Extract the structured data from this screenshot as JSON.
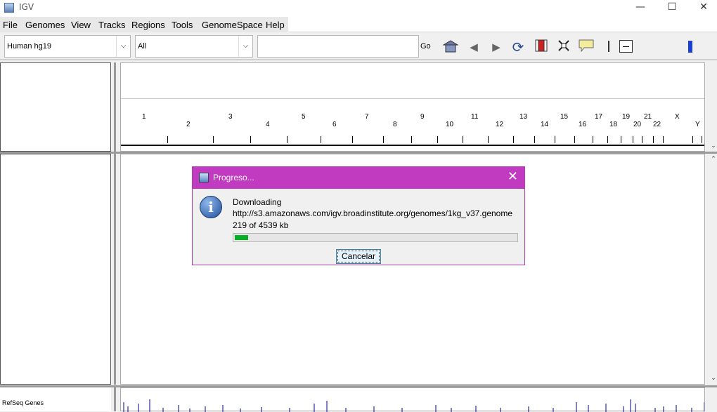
{
  "window": {
    "title": "IGV",
    "minimize": "—",
    "maximize": "☐",
    "close": "✕"
  },
  "menu": [
    "File",
    "Genomes",
    "View",
    "Tracks",
    "Regions",
    "Tools",
    "GenomeSpace",
    "Help"
  ],
  "toolbar": {
    "genome": "Human hg19",
    "chromosome": "All",
    "locus_value": "",
    "go_label": "Go",
    "icons": [
      "home-icon",
      "back-icon",
      "forward-icon",
      "refresh-icon",
      "roi-icon",
      "resize-icon",
      "popup-text-icon",
      "ruler-icon",
      "zoom-out-icon",
      "zoom-level-icon"
    ]
  },
  "ruler": {
    "chromosomes_top": [
      "1",
      "3",
      "5",
      "7",
      "9",
      "11",
      "13",
      "15",
      "17",
      "19",
      "21",
      "X"
    ],
    "chromosomes_bottom": [
      "2",
      "4",
      "6",
      "8",
      "10",
      "12",
      "14",
      "16",
      "18",
      "20",
      "22",
      "Y"
    ]
  },
  "dialog": {
    "title": "Progreso...",
    "line1": "Downloading",
    "line2": "http://s3.amazonaws.com/igv.broadinstitute.org/genomes/1kg_v37.genome",
    "line3": "219 of 4539 kb",
    "progress_fraction": 0.048,
    "cancel_label": "Cancelar"
  },
  "tracks": {
    "refseq_label": "RefSeq Genes"
  },
  "colors": {
    "dialog_title": "#c13bc1",
    "progress": "#06b025",
    "feature": "#00008b",
    "zoom_marker": "#1a3fd6"
  }
}
